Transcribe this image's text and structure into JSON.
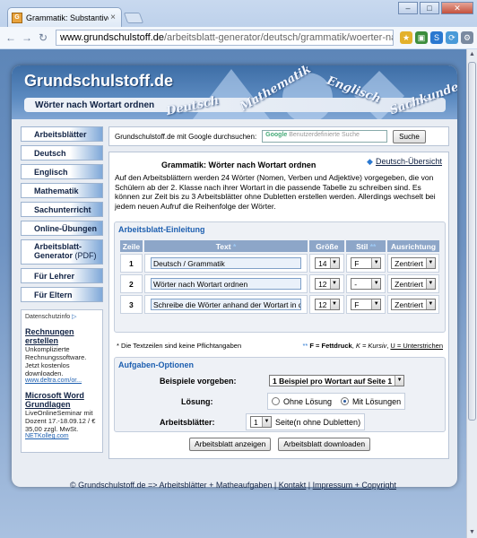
{
  "browser": {
    "tab_title": "Grammatik: Substantive, V",
    "tab_close": "×",
    "url_host": "www.grundschulstoff.de",
    "url_path": "/arbeitsblatt-generator/deutsch/grammatik/woerter-nach-wo",
    "back": "←",
    "forward": "→",
    "reload": "↻"
  },
  "header": {
    "logo": "Grundschulstoff.de",
    "subtitle": "Wörter nach Wortart ordnen",
    "deco_words": [
      "Deutsch",
      "Mathematik",
      "Englisch",
      "Sachkunde"
    ]
  },
  "sidebar": {
    "items": [
      {
        "label": "Arbeitsblätter"
      },
      {
        "label": "Deutsch"
      },
      {
        "label": "Englisch"
      },
      {
        "label": "Mathematik"
      },
      {
        "label": "Sachunterricht"
      },
      {
        "label": "Online-Übungen"
      },
      {
        "label": "Arbeitsblatt-Generator",
        "suffix": "(PDF)"
      },
      {
        "label": "Für Lehrer"
      },
      {
        "label": "Für Eltern"
      }
    ]
  },
  "ads": {
    "choices": "Datenschutzinfo",
    "items": [
      {
        "title": "Rechnungen erstellen",
        "text": "Unkomplizierte Rechnungssoftware. Jetzt kostenlos downloaden.",
        "url": "www.deltra.com/or..."
      },
      {
        "title": "Microsoft Word Grundlagen",
        "text": "LiveOnlineSeminar mit Dozent 17.-18.09.12 / € 35,00 zzgl. MwSt.",
        "url": "NETKolleg.com"
      }
    ]
  },
  "search": {
    "label": "Grundschulstoff.de mit Google durchsuchen:",
    "placeholder": "Benutzerdefinierte Suche",
    "google": "Google",
    "button": "Suche"
  },
  "content": {
    "title": "Grammatik: Wörter nach Wortart ordnen",
    "overview_link": "Deutsch-Übersicht",
    "intro": "Auf den Arbeitsblättern werden 24 Wörter (Nomen, Verben und Adjektive) vorgegeben, die von Schülern ab der 2. Klasse nach ihrer Wortart in die passende Tabelle zu schreiben sind. Es können zur Zeit bis zu 3 Arbeitsblätter ohne Dubletten erstellen werden. Allerdings wechselt bei jedem neuen Aufruf die Reihenfolge der Wörter."
  },
  "setup": {
    "heading": "Arbeitsblatt-Einleitung",
    "columns": {
      "zeile": "Zeile",
      "text": "Text",
      "text_ast": "*",
      "groesse": "Größe",
      "stil": "Stil",
      "stil_ast": "**",
      "ausrichtung": "Ausrichtung"
    },
    "rows": [
      {
        "num": "1",
        "text": "Deutsch / Grammatik",
        "size": "14",
        "style": "F",
        "align": "Zentriert"
      },
      {
        "num": "2",
        "text": "Wörter nach Wortart ordnen",
        "size": "12",
        "style": "-",
        "align": "Zentriert"
      },
      {
        "num": "3",
        "text": "Schreibe die Wörter anhand der Wortart in di",
        "size": "12",
        "style": "F",
        "align": "Zentriert"
      }
    ],
    "legend_left": "* Die Textzeilen sind keine Pflichtangaben",
    "legend_ast": "**",
    "legend_f": "F = Fettdruck",
    "legend_k": "K = Kursiv",
    "legend_u": "U = Unterstrichen"
  },
  "options": {
    "heading": "Aufgaben-Optionen",
    "examples_label": "Beispiele vorgeben:",
    "examples_value": "1 Beispiel pro Wortart auf Seite 1",
    "solution_label": "Lösung:",
    "solution_off": "Ohne Lösung",
    "solution_on": "Mit Lösungen",
    "sheets_label": "Arbeitsblätter:",
    "sheets_value": "1",
    "sheets_suffix": "Seite(n ohne Dubletten)"
  },
  "actions": {
    "show": "Arbeitsblatt anzeigen",
    "download": "Arbeitsblatt downloaden"
  },
  "footer": {
    "text": "© Grundschulstoff.de => Arbeitsblätter + Matheaufgaben |",
    "kontakt": "Kontakt",
    "sep": "|",
    "impressum": "Impressum + Copyright"
  }
}
